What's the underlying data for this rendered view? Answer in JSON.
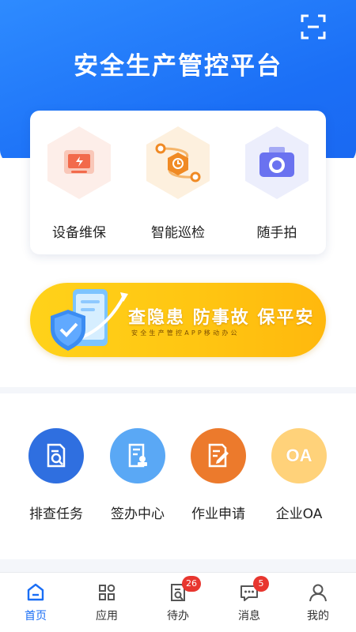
{
  "header": {
    "title": "安全生产管控平台",
    "scan_icon": "scan-icon"
  },
  "quick_actions": [
    {
      "label": "设备维保",
      "icon": "equipment-maintenance-icon",
      "color": "#f26a4b"
    },
    {
      "label": "智能巡检",
      "icon": "patrol-route-icon",
      "color": "#f08a24"
    },
    {
      "label": "随手拍",
      "icon": "camera-icon",
      "color": "#6a72f0"
    }
  ],
  "banner": {
    "title": "查隐患 防事故 保平安",
    "subtitle": "安全生产管控APP移动办公"
  },
  "functions": [
    {
      "label": "排查任务",
      "icon": "inspection-task-icon",
      "color": "#2f6fe0"
    },
    {
      "label": "签办中心",
      "icon": "sign-document-icon",
      "color": "#5aa8f5"
    },
    {
      "label": "作业申请",
      "icon": "work-application-icon",
      "color": "#ec7a2c"
    },
    {
      "label": "企业OA",
      "icon": "oa-icon",
      "color": "#ffd27a",
      "icon_text": "OA"
    }
  ],
  "tabbar": [
    {
      "label": "首页",
      "icon": "home-icon",
      "active": true
    },
    {
      "label": "应用",
      "icon": "apps-grid-icon",
      "active": false
    },
    {
      "label": "待办",
      "icon": "todo-icon",
      "active": false,
      "badge": "26"
    },
    {
      "label": "消息",
      "icon": "message-icon",
      "active": false,
      "badge": "5"
    },
    {
      "label": "我的",
      "icon": "profile-icon",
      "active": false
    }
  ],
  "colors": {
    "brand_blue": "#1a6ef5",
    "banner_yellow": "#ffc612",
    "badge_red": "#e8362f"
  }
}
